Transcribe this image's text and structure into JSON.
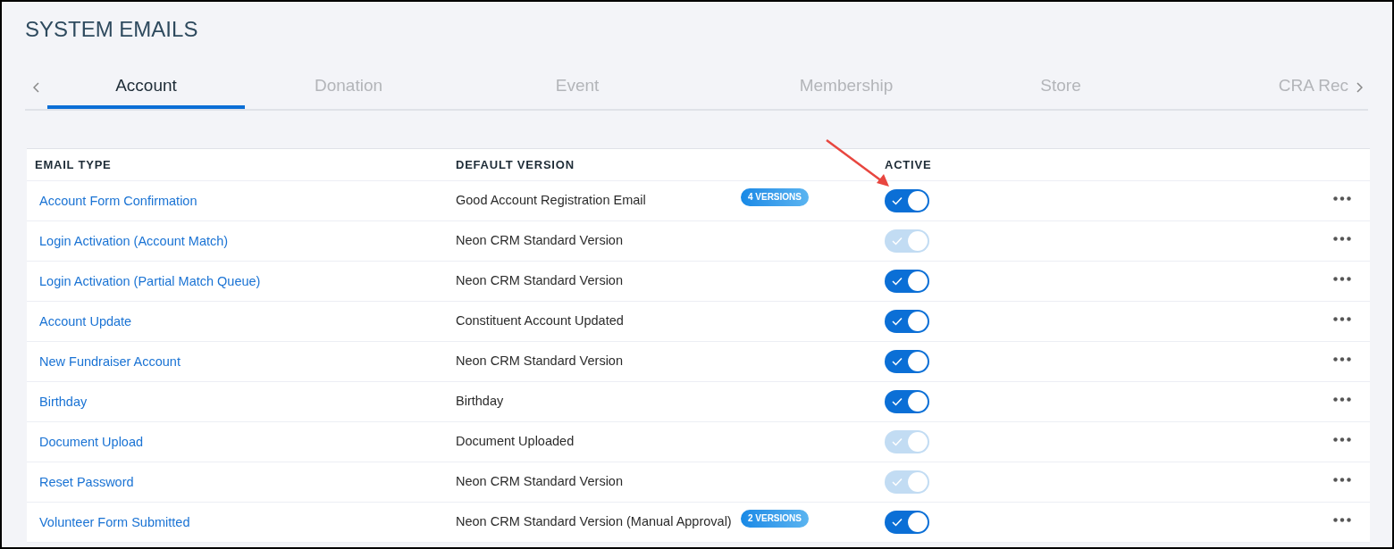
{
  "page_title": "SYSTEM EMAILS",
  "tabs": [
    {
      "label": "Account",
      "selected": true
    },
    {
      "label": "Donation",
      "selected": false
    },
    {
      "label": "Event",
      "selected": false
    },
    {
      "label": "Membership",
      "selected": false
    },
    {
      "label": "Store",
      "selected": false
    },
    {
      "label": "CRA Rec",
      "selected": false
    }
  ],
  "table": {
    "columns": [
      "EMAIL TYPE",
      "DEFAULT VERSION",
      "ACTIVE"
    ],
    "rows": [
      {
        "email_type": "Account Form Confirmation",
        "default_version": "Good Account Registration Email",
        "versions_badge": "4 VERSIONS",
        "active": {
          "on": true,
          "disabled": false
        }
      },
      {
        "email_type": "Login Activation (Account Match)",
        "default_version": "Neon CRM Standard Version",
        "active": {
          "on": true,
          "disabled": true
        }
      },
      {
        "email_type": "Login Activation (Partial Match Queue)",
        "default_version": "Neon CRM Standard Version",
        "active": {
          "on": true,
          "disabled": false
        }
      },
      {
        "email_type": "Account Update",
        "default_version": "Constituent Account Updated",
        "active": {
          "on": true,
          "disabled": false
        }
      },
      {
        "email_type": "New Fundraiser Account",
        "default_version": "Neon CRM Standard Version",
        "active": {
          "on": true,
          "disabled": false
        }
      },
      {
        "email_type": "Birthday",
        "default_version": "Birthday",
        "active": {
          "on": true,
          "disabled": false
        }
      },
      {
        "email_type": "Document Upload",
        "default_version": "Document Uploaded",
        "active": {
          "on": true,
          "disabled": true
        }
      },
      {
        "email_type": "Reset Password",
        "default_version": "Neon CRM Standard Version",
        "active": {
          "on": true,
          "disabled": true
        }
      },
      {
        "email_type": "Volunteer Form Submitted",
        "default_version": "Neon CRM Standard Version (Manual Approval)",
        "versions_badge": "2 VERSIONS",
        "active": {
          "on": true,
          "disabled": false
        }
      }
    ]
  }
}
